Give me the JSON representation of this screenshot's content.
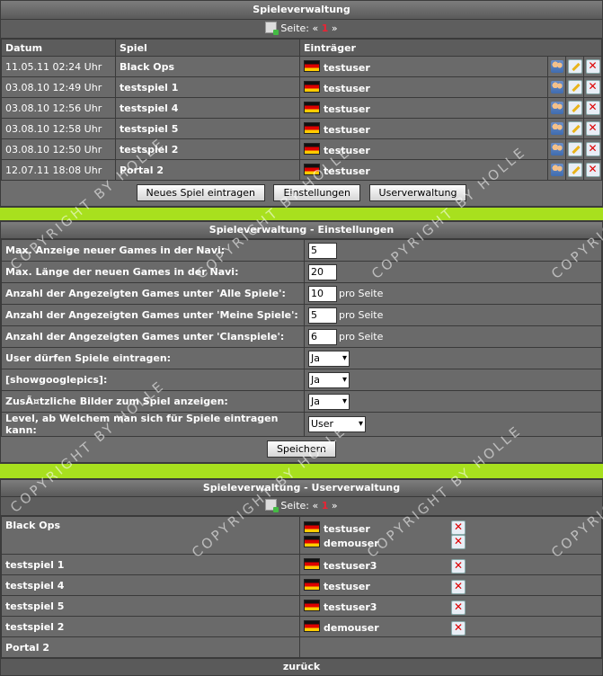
{
  "games": {
    "title": "Spieleverwaltung",
    "pager": {
      "label": "Seite:",
      "prev": "«",
      "current": "1",
      "next": "»"
    },
    "columns": [
      "Datum",
      "Spiel",
      "Einträger"
    ],
    "rows": [
      {
        "date": "11.05.11 02:24 Uhr",
        "game": "Black Ops",
        "user": "testuser"
      },
      {
        "date": "03.08.10 12:49 Uhr",
        "game": "testspiel 1",
        "user": "testuser"
      },
      {
        "date": "03.08.10 12:56 Uhr",
        "game": "testspiel 4",
        "user": "testuser"
      },
      {
        "date": "03.08.10 12:58 Uhr",
        "game": "testspiel 5",
        "user": "testuser"
      },
      {
        "date": "03.08.10 12:50 Uhr",
        "game": "testspiel 2",
        "user": "testuser"
      },
      {
        "date": "12.07.11 18:08 Uhr",
        "game": "Portal 2",
        "user": "testuser"
      }
    ],
    "buttons": {
      "new": "Neues Spiel eintragen",
      "settings": "Einstellungen",
      "users": "Userverwaltung"
    }
  },
  "settings": {
    "title": "Spieleverwaltung - Einstellungen",
    "rows": [
      {
        "label": "Max. Anzeige neuer Games in der Navi:",
        "value": "5",
        "unit": ""
      },
      {
        "label": "Max. Länge der neuen Games in der Navi:",
        "value": "20",
        "unit": ""
      },
      {
        "label": "Anzahl der Angezeigten Games unter 'Alle Spiele':",
        "value": "10",
        "unit": "pro Seite"
      },
      {
        "label": "Anzahl der Angezeigten Games unter 'Meine Spiele':",
        "value": "5",
        "unit": "pro Seite"
      },
      {
        "label": "Anzahl der Angezeigten Games unter 'Clanspiele':",
        "value": "6",
        "unit": "pro Seite"
      }
    ],
    "selects": [
      {
        "label": "User dürfen Spiele eintragen:",
        "value": "Ja"
      },
      {
        "label": "[showgooglepics]:",
        "value": "Ja"
      },
      {
        "label": "ZusÃ¤tzliche Bilder zum Spiel anzeigen:",
        "value": "Ja"
      },
      {
        "label": "Level, ab Welchem man sich für Spiele eintragen kann:",
        "value": "User"
      }
    ],
    "save": "Speichern"
  },
  "users": {
    "title": "Spieleverwaltung - Userverwaltung",
    "pager": {
      "label": "Seite:",
      "prev": "«",
      "current": "1",
      "next": "»"
    },
    "rows": [
      {
        "game": "Black Ops",
        "user1": "testuser",
        "user2": "demouser"
      },
      {
        "game": "testspiel 1",
        "user1": "testuser3"
      },
      {
        "game": "testspiel 4",
        "user1": "testuser"
      },
      {
        "game": "testspiel 5",
        "user1": "testuser3"
      },
      {
        "game": "testspiel 2",
        "user1": "demouser"
      },
      {
        "game": "Portal 2"
      }
    ],
    "back": "zurück"
  },
  "watermark": "COPYRIGHT BY HOLLE",
  "colors": {
    "accent_bar": "#a8e01e",
    "flag": "de"
  }
}
